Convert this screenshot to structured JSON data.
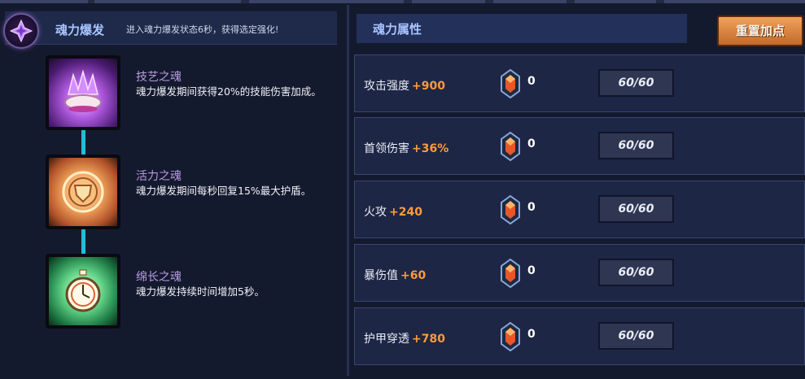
{
  "burst": {
    "title": "魂力爆发",
    "description": "进入魂力爆发状态6秒，获得选定强化!"
  },
  "souls": [
    {
      "name": "技艺之魂",
      "description": "魂力爆发期间获得20%的技能伤害加成。",
      "icon": "purple-crystal-shell-icon"
    },
    {
      "name": "活力之魂",
      "description": "魂力爆发期间每秒回复15%最大护盾。",
      "icon": "orange-shield-emblem-icon"
    },
    {
      "name": "绵长之魂",
      "description": "魂力爆发持续时间增加5秒。",
      "icon": "green-stopwatch-icon"
    }
  ],
  "attributes": {
    "title": "魂力属性",
    "reset_label": "重置加点",
    "rows": [
      {
        "name": "攻击强度",
        "bonus": "+900",
        "gems": "0",
        "level": "60/60"
      },
      {
        "name": "首领伤害",
        "bonus": "+36%",
        "gems": "0",
        "level": "60/60"
      },
      {
        "name": "火攻",
        "bonus": "+240",
        "gems": "0",
        "level": "60/60"
      },
      {
        "name": "暴伤值",
        "bonus": "+60",
        "gems": "0",
        "level": "60/60"
      },
      {
        "name": "护甲穿透",
        "bonus": "+780",
        "gems": "0",
        "level": "60/60"
      }
    ]
  },
  "colors": {
    "background": "#141a2e",
    "accent_orange": "#ff9a3a",
    "title_blue": "#a8c4ff",
    "soul_name": "#b99ae0",
    "connector": "#1ec0d8"
  }
}
